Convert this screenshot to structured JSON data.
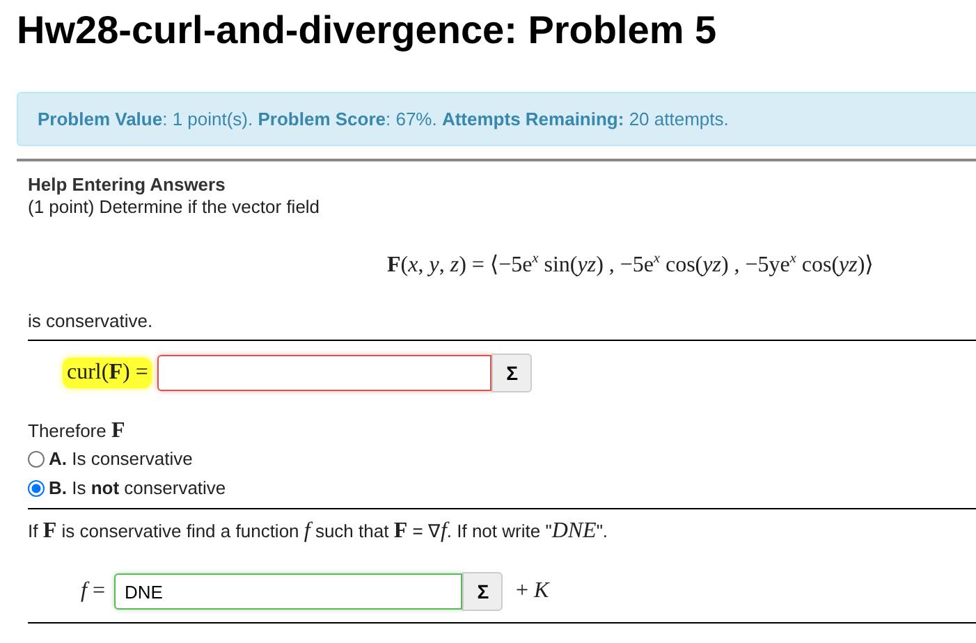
{
  "title": "Hw28-curl-and-divergence: Problem 5",
  "info_bar": "**Problem Value**: 1 point(s). **Problem Score**: 67%. **Attempts Remaining:** 20 attempts.",
  "help_link": "Help Entering Answers",
  "intro": "(1 point) Determine if the vector field",
  "formula": "**F**(*x*, *y*, *z*) = ⟨−5e$^{x}$ sin(*yz*) , −5e$^{x}$ cos(*yz*) , −5ye$^{x}$ cos(*yz*)⟩",
  "after_formula": "is conservative.",
  "answer_1": {
    "label": "curl(**F**) =",
    "highlighted": true,
    "correct": false,
    "tool_button": "Σ"
  },
  "therefore": "Therefore **F**",
  "options": [
    {
      "letter": "A.",
      "text": "Is conservative",
      "selected": false
    },
    {
      "letter": "B.",
      "text": "Is **not** conservative",
      "selected": true
    }
  ],
  "question": "If **F** is conservative find a function *f* such that **F** = ∇*f*. If not write \"*DNE*\".",
  "answer_2": {
    "label": "*f* =",
    "value": "DNE",
    "correct": true,
    "tool_button": "Σ",
    "suffix": "+ *K*"
  }
}
